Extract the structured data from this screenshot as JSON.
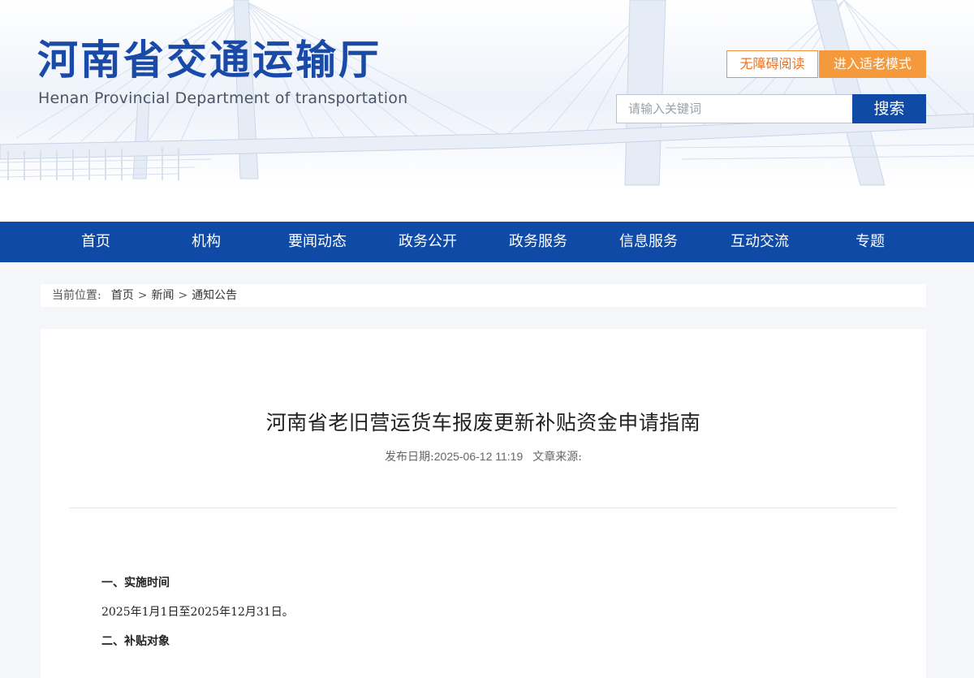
{
  "header": {
    "title_cn": "河南省交通运输厅",
    "title_en": "Henan Provincial Department of transportation",
    "accessibility_label": "无障碍阅读",
    "elder_mode_label": "进入适老模式",
    "search": {
      "placeholder": "请输入关键词",
      "button_label": "搜索"
    }
  },
  "nav": {
    "items": [
      {
        "label": "首页"
      },
      {
        "label": "机构"
      },
      {
        "label": "要闻动态"
      },
      {
        "label": "政务公开"
      },
      {
        "label": "政务服务"
      },
      {
        "label": "信息服务"
      },
      {
        "label": "互动交流"
      },
      {
        "label": "专题"
      }
    ]
  },
  "breadcrumb": {
    "label": "当前位置:",
    "items": [
      "首页",
      "新闻",
      "通知公告"
    ],
    "separator": ">"
  },
  "article": {
    "title": "河南省老旧营运货车报废更新补贴资金申请指南",
    "date_label": "发布日期:",
    "date": "2025-06-12 11:19",
    "source_label": "文章来源:",
    "sections": [
      {
        "text": "一、实施时间"
      },
      {
        "text": "2025年1月1日至2025年12月31日。"
      },
      {
        "text": "二、补贴对象"
      }
    ]
  },
  "colors": {
    "primary_blue": "#0e4aa6",
    "accent_orange": "#f59a3c",
    "page_bg": "#f4f6fa"
  }
}
